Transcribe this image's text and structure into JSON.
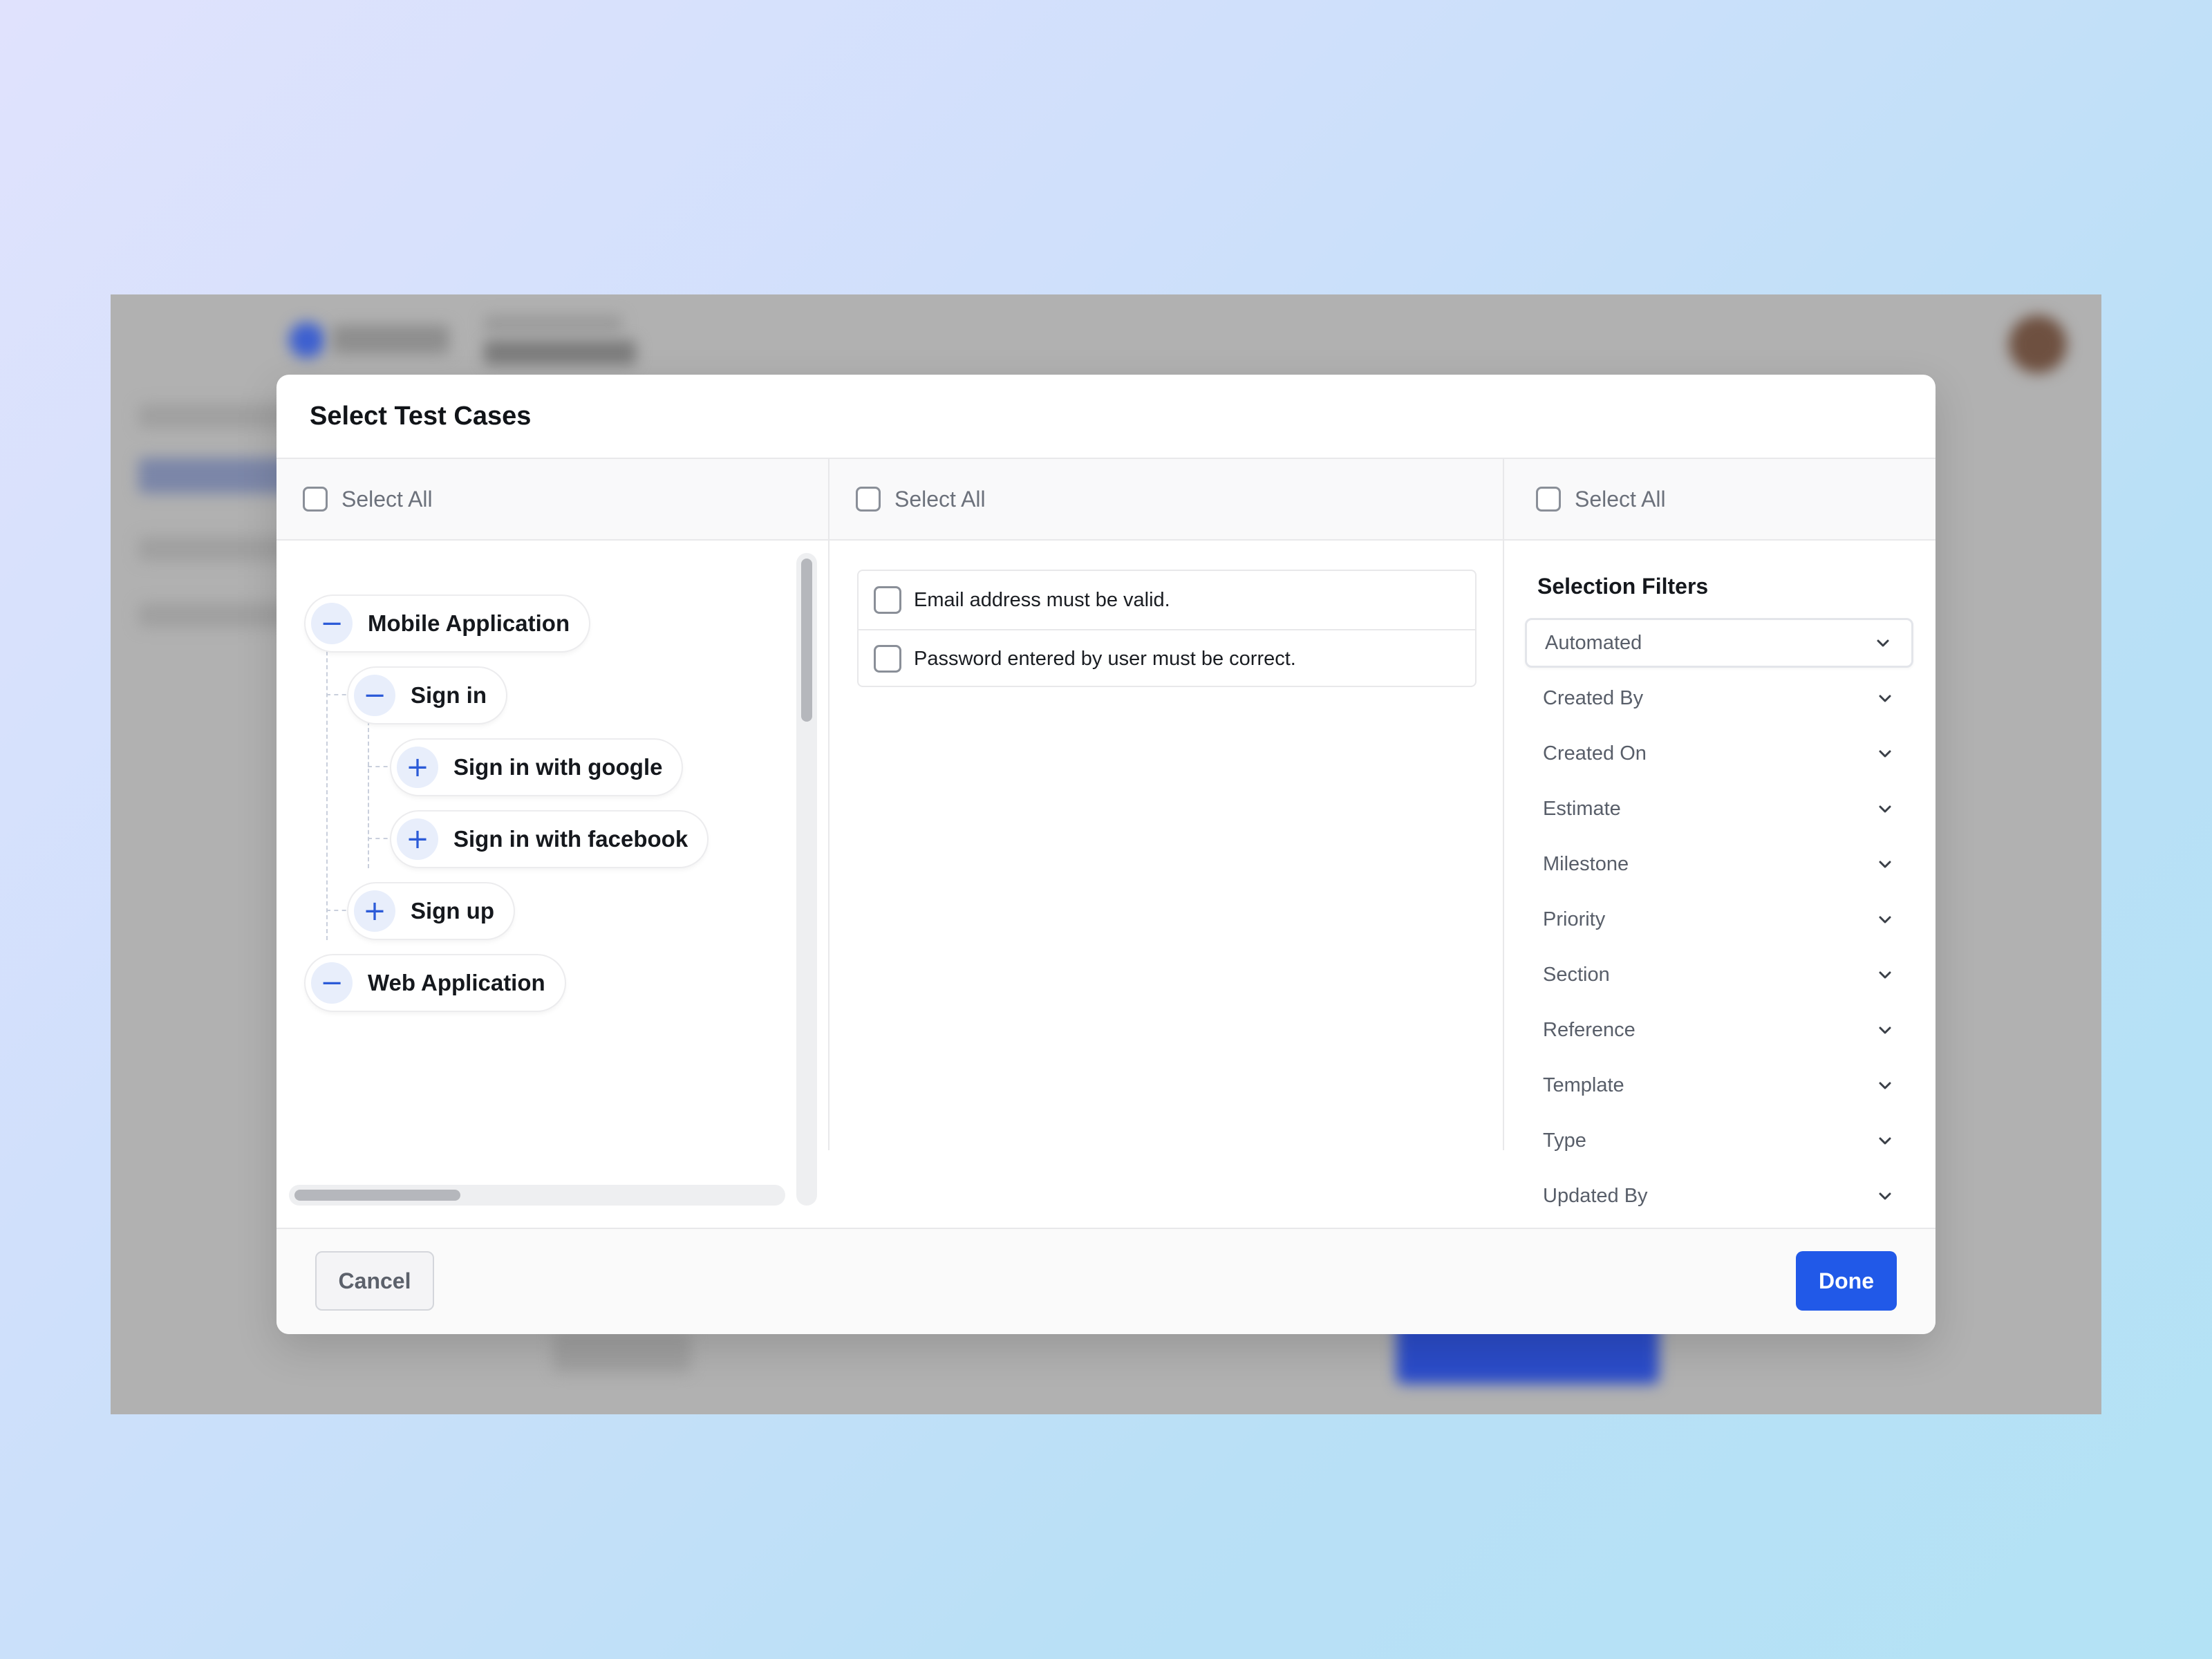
{
  "modal": {
    "title": "Select Test Cases",
    "select_all_label": "Select All"
  },
  "tree": {
    "nodes": [
      {
        "label": "Mobile Application",
        "toggle": "−",
        "state": "expanded"
      },
      {
        "label": "Sign in",
        "toggle": "−",
        "state": "expanded"
      },
      {
        "label": "Sign in with google",
        "toggle": "+",
        "state": "collapsed"
      },
      {
        "label": "Sign in with facebook",
        "toggle": "+",
        "state": "collapsed"
      },
      {
        "label": "Sign up",
        "toggle": "+",
        "state": "collapsed"
      },
      {
        "label": "Web Application",
        "toggle": "−",
        "state": "expanded"
      }
    ]
  },
  "test_cases": [
    {
      "label": "Email address must be valid.",
      "checked": false
    },
    {
      "label": "Password entered by user must be correct.",
      "checked": false
    }
  ],
  "filters": {
    "title": "Selection Filters",
    "items": [
      "Automated",
      "Created By",
      "Created On",
      "Estimate",
      "Milestone",
      "Priority",
      "Section",
      "Reference",
      "Template",
      "Type",
      "Updated By"
    ],
    "active_item": "Automated"
  },
  "footer": {
    "cancel_label": "Cancel",
    "done_label": "Done"
  },
  "colors": {
    "accent": "#2159e8",
    "toggle_bg": "#e8eefb",
    "overlay": "#b1b1b1"
  }
}
